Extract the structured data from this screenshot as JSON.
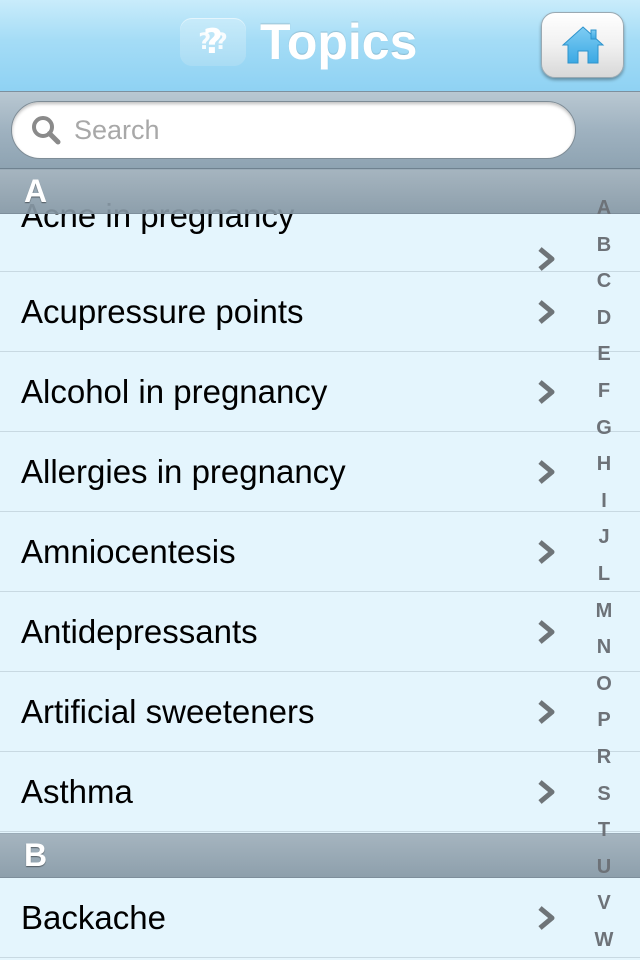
{
  "header": {
    "title": "Topics",
    "logo_icon": "question-marks-icon",
    "home_icon": "home-icon",
    "accent_color": "#8fd2f3"
  },
  "search": {
    "placeholder": "Search",
    "value": "",
    "icon": "magnifier-icon"
  },
  "sections": [
    {
      "header": "A",
      "items": [
        "Acne in pregnancy",
        "Acupressure points",
        "Alcohol in pregnancy",
        "Allergies in pregnancy",
        "Amniocentesis",
        "Antidepressants",
        "Artificial sweeteners",
        "Asthma"
      ]
    },
    {
      "header": "B",
      "items": [
        "Backache"
      ]
    }
  ],
  "index_letters": [
    "A",
    "B",
    "C",
    "D",
    "E",
    "F",
    "G",
    "H",
    "I",
    "J",
    "L",
    "M",
    "N",
    "O",
    "P",
    "R",
    "S",
    "T",
    "U",
    "V",
    "W"
  ]
}
